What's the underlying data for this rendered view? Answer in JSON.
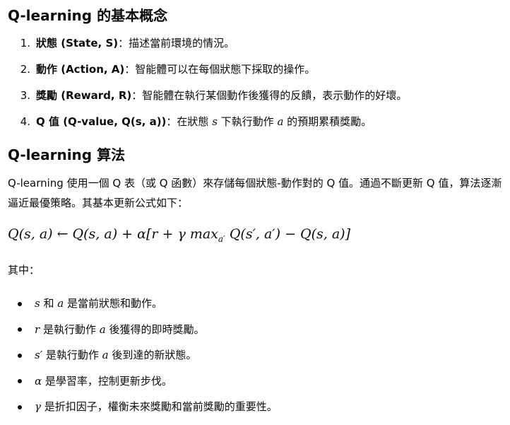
{
  "section1": {
    "heading": "Q-learning 的基本概念",
    "items": [
      {
        "number": "1.",
        "term": "狀態 (State, S)",
        "desc": "：描述當前環境的情況。"
      },
      {
        "number": "2.",
        "term": "動作 (Action, A)",
        "desc": "：智能體可以在每個狀態下採取的操作。"
      },
      {
        "number": "3.",
        "term": "獎勵 (Reward, R)",
        "desc": "：智能體在執行某個動作後獲得的反饋，表示動作的好壞。"
      },
      {
        "number": "4.",
        "term": "Q 值 (Q-value, Q(s, a))",
        "desc_pre": "：在狀態 ",
        "var1": "s",
        "desc_mid": " 下執行動作 ",
        "var2": "a",
        "desc_post": " 的預期累積獎勵。"
      }
    ]
  },
  "section2": {
    "heading": "Q-learning 算法",
    "paragraph": "Q-learning 使用一個 Q 表（或 Q 函數）來存儲每個狀態-動作對的 Q 值。通過不斷更新 Q 值，算法逐漸逼近最優策略。其基本更新公式如下：",
    "formula_main": "Q(s, a) ← Q(s, a) + α[r + γ max",
    "formula_sub": "a′",
    "formula_tail": " Q(s′, a′) − Q(s, a)]",
    "where_label": "其中：",
    "notes": [
      {
        "var": "s",
        "mid": " 和 ",
        "var2": "a",
        "text": " 是當前狀態和動作。"
      },
      {
        "var": "r",
        "text_pre": " 是執行動作 ",
        "var2": "a",
        "text": " 後獲得的即時獎勵。"
      },
      {
        "var": "s′",
        "text_pre": " 是執行動作 ",
        "var2": "a",
        "text": " 後到達的新狀態。"
      },
      {
        "var": "α",
        "text": " 是學習率，控制更新步伐。"
      },
      {
        "var": "γ",
        "text": " 是折扣因子，權衡未來獎勵和當前獎勵的重要性。"
      }
    ]
  }
}
